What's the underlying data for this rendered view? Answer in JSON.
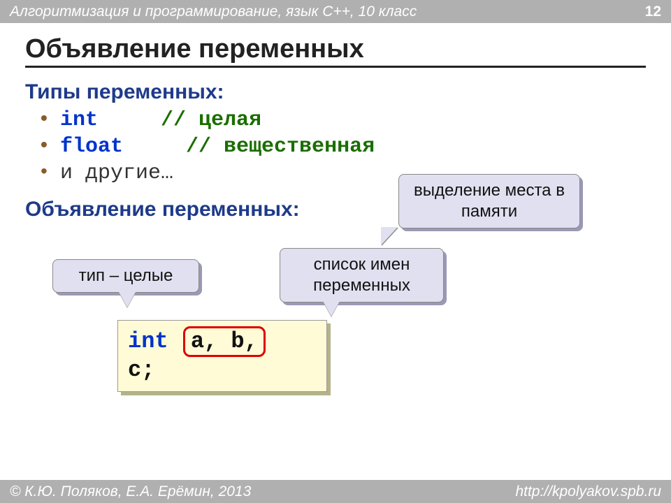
{
  "header": {
    "course": "Алгоритмизация и программирование, язык  C++, 10 класс",
    "page": "12"
  },
  "title": "Объявление  переменных",
  "types": {
    "heading": "Типы переменных:",
    "items": [
      {
        "kw": "int",
        "comment": "// целая"
      },
      {
        "kw": "float",
        "comment": "// вещественная"
      }
    ],
    "more": "и другие…"
  },
  "decl": {
    "heading": "Объявление переменных:"
  },
  "callouts": {
    "mem": "выделение места в памяти",
    "type": "тип – целые",
    "list": "список имен переменных"
  },
  "code": {
    "kw": "int",
    "vars": "a, b,",
    "tail": " c;"
  },
  "footer": {
    "authors": "© К.Ю. Поляков, Е.А. Ерёмин, 2013",
    "url": "http://kpolyakov.spb.ru"
  }
}
